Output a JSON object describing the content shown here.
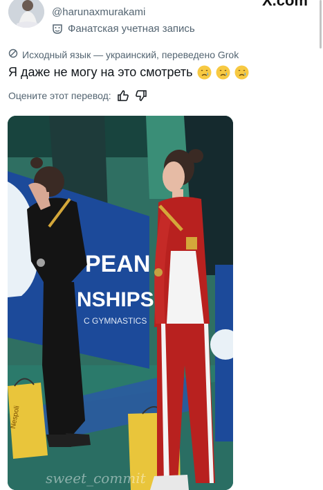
{
  "header": {
    "brand": "X.com",
    "handle": "@harunaxmurakami",
    "account_badge": "Фанатская учетная запись",
    "avatar_icon": "user-avatar-icon",
    "badge_icon": "theater-mask-icon"
  },
  "translation": {
    "source_line": "Исходный язык — украинский, переведено Grok",
    "source_icon": "translate-icon"
  },
  "tweet": {
    "text": "Я даже не могу на это смотреть",
    "emojis": [
      "crying-face-icon",
      "crying-face-icon",
      "crying-face-icon"
    ]
  },
  "rating": {
    "prompt": "Оцените этот перевод:",
    "like_icon": "thumbs-up-icon",
    "dislike_icon": "thumbs-down-icon"
  },
  "media": {
    "banner_lines": [
      "PEAN",
      "NSHIPS",
      "C GYMNASTICS"
    ],
    "bag_text": "Nespoli",
    "watermark": "sweet_commit",
    "image_icon": "photo-icon"
  },
  "colors": {
    "text_primary": "#0f1419",
    "text_secondary": "#536471",
    "arena_green": "#2d7060",
    "banner_blue": "#1c4a9a",
    "uniform_red": "#b8211f",
    "bag_yellow": "#e9c53b"
  }
}
